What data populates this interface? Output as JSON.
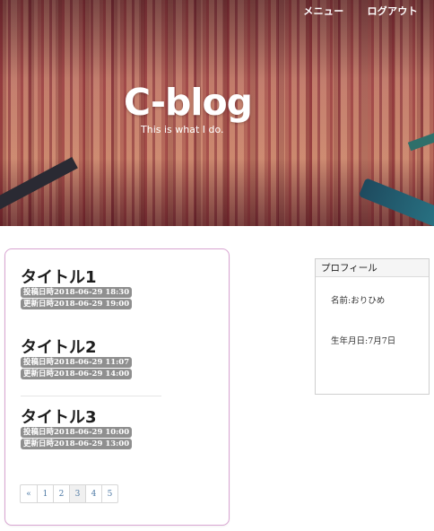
{
  "header": {
    "nav": [
      {
        "label": "メニュー"
      },
      {
        "label": "ログアウト"
      }
    ],
    "site_title": "C-blog",
    "tagline": "This is what I do."
  },
  "posts": [
    {
      "title": "タイトル1",
      "posted": "投稿日時2018-06-29 18:30",
      "updated": "更新日時2018-06-29 19:00"
    },
    {
      "title": "タイトル2",
      "posted": "投稿日時2018-06-29 11:07",
      "updated": "更新日時2018-06-29 14:00"
    },
    {
      "title": "タイトル3",
      "posted": "投稿日時2018-06-29 10:00",
      "updated": "更新日時2018-06-29 13:00"
    }
  ],
  "pagination": {
    "prev": "«",
    "pages": [
      "1",
      "2",
      "3",
      "4",
      "5"
    ]
  },
  "profile": {
    "heading": "プロフィール",
    "name": "名前:おりひめ",
    "birthday": "生年月日:7月7日"
  },
  "colors": {
    "panel_border": "#d9a5d2",
    "badge_bg": "#8f8f8f",
    "link": "#4f7aa5"
  }
}
